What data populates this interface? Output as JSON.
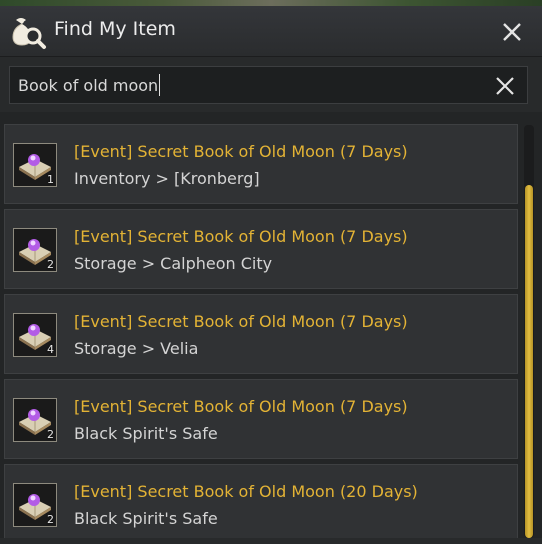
{
  "window": {
    "title": "Find My Item",
    "title_icon": "bag-search-icon",
    "close_icon": "close-icon"
  },
  "search": {
    "value": "Book of old moon",
    "clear_icon": "clear-icon"
  },
  "results": [
    {
      "name": "[Event] Secret Book of Old Moon (7 Days)",
      "location": "Inventory > [Kronberg]",
      "quantity": "1"
    },
    {
      "name": "[Event] Secret Book of Old Moon (7 Days)",
      "location": "Storage > Calpheon City",
      "quantity": "2"
    },
    {
      "name": "[Event] Secret Book of Old Moon (7 Days)",
      "location": "Storage > Velia",
      "quantity": "4"
    },
    {
      "name": "[Event] Secret Book of Old Moon (7 Days)",
      "location": "Black Spirit's Safe",
      "quantity": "2"
    },
    {
      "name": "[Event] Secret Book of Old Moon (20 Days)",
      "location": "Black Spirit's Safe",
      "quantity": "2"
    }
  ],
  "colors": {
    "item_name": "#e3b335",
    "scroll_thumb": "#e2bd40"
  }
}
